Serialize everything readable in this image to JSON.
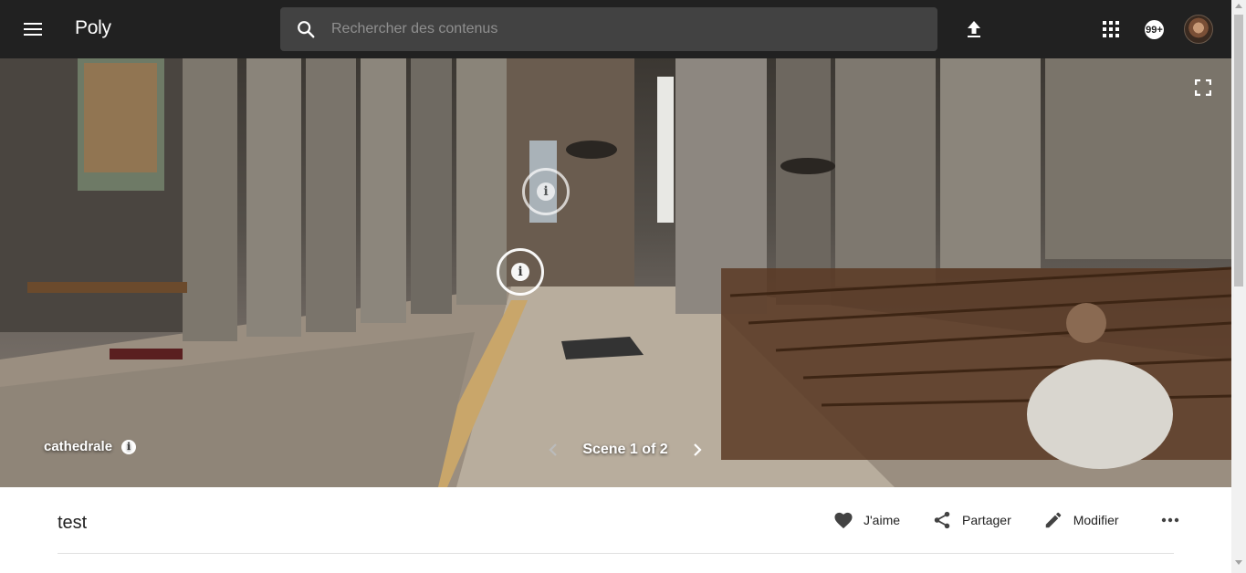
{
  "header": {
    "app_name": "Poly",
    "search_placeholder": "Rechercher des contenus",
    "notification_count": "99+",
    "icons": [
      "menu-icon",
      "search-icon",
      "upload-icon",
      "apps-grid-icon",
      "avatar"
    ]
  },
  "viewer": {
    "scene_name": "cathedrale",
    "scene_counter": "Scene 1 of 2",
    "hotspots": [
      "info-hotspot",
      "info-hotspot"
    ],
    "icons": [
      "fullscreen-icon",
      "info-icon",
      "chevron-left-icon",
      "chevron-right-icon"
    ]
  },
  "content": {
    "title": "test",
    "actions": {
      "like": "J'aime",
      "share": "Partager",
      "edit": "Modifier"
    },
    "icons": [
      "heart-icon",
      "share-icon",
      "pencil-icon",
      "more-horiz-icon"
    ]
  },
  "colors": {
    "header_bg": "#212121",
    "search_bg": "#424242",
    "text_primary": "#212121"
  }
}
